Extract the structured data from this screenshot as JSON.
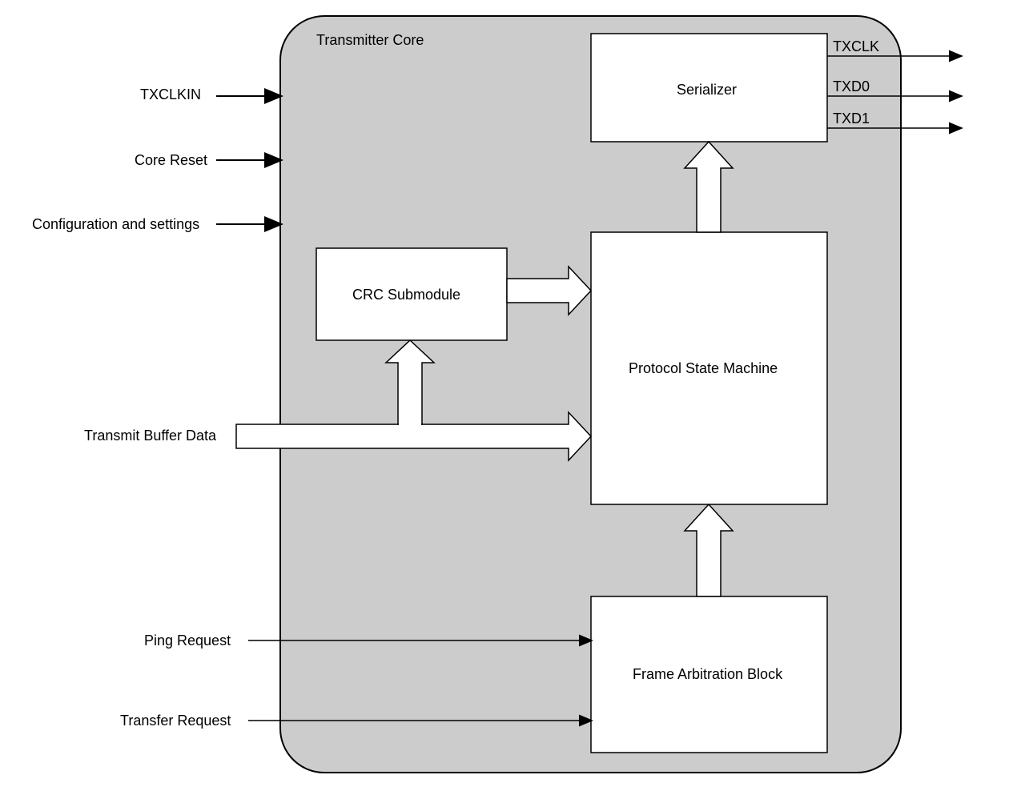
{
  "core_title": "Transmitter Core",
  "blocks": {
    "serializer": "Serializer",
    "crc": "CRC Submodule",
    "psm": "Protocol State Machine",
    "fab": "Frame Arbitration Block"
  },
  "inputs": {
    "txclkin": "TXCLKIN",
    "core_reset": "Core Reset",
    "config": "Configuration and settings",
    "buffer": "Transmit Buffer Data",
    "ping": "Ping Request",
    "transfer": "Transfer Request"
  },
  "outputs": {
    "txclk": "TXCLK",
    "txd0": "TXD0",
    "txd1": "TXD1"
  }
}
